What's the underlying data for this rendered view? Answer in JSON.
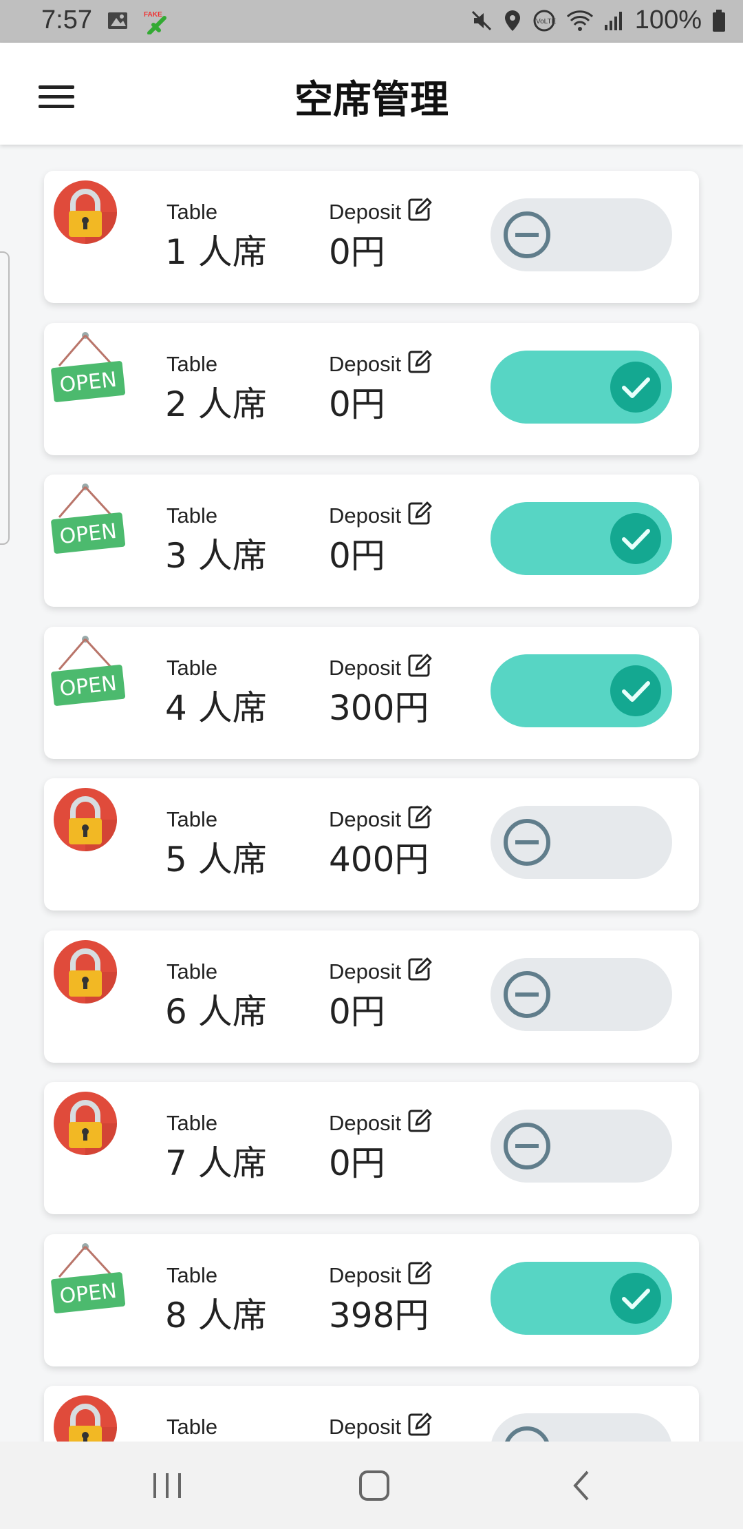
{
  "status_bar": {
    "time": "7:57",
    "battery": "100%"
  },
  "app_bar": {
    "title": "空席管理"
  },
  "tables": [
    {
      "table_label": "Table",
      "name": "1 人席",
      "deposit_label": "Deposit",
      "deposit": "0円",
      "status": "closed"
    },
    {
      "table_label": "Table",
      "name": "2 人席",
      "deposit_label": "Deposit",
      "deposit": "0円",
      "status": "open"
    },
    {
      "table_label": "Table",
      "name": "3 人席",
      "deposit_label": "Deposit",
      "deposit": "0円",
      "status": "open"
    },
    {
      "table_label": "Table",
      "name": "4 人席",
      "deposit_label": "Deposit",
      "deposit": "300円",
      "status": "open"
    },
    {
      "table_label": "Table",
      "name": "5 人席",
      "deposit_label": "Deposit",
      "deposit": "400円",
      "status": "closed"
    },
    {
      "table_label": "Table",
      "name": "6 人席",
      "deposit_label": "Deposit",
      "deposit": "0円",
      "status": "closed"
    },
    {
      "table_label": "Table",
      "name": "7 人席",
      "deposit_label": "Deposit",
      "deposit": "0円",
      "status": "closed"
    },
    {
      "table_label": "Table",
      "name": "8 人席",
      "deposit_label": "Deposit",
      "deposit": "398円",
      "status": "open"
    },
    {
      "table_label": "Table",
      "name": "",
      "deposit_label": "Deposit",
      "deposit": "",
      "status": "closed"
    }
  ],
  "open_sign_text": "OPEN",
  "colors": {
    "toggle_on": "#57d5c4",
    "toggle_off": "#e6e9ec",
    "check_knob": "#14a891",
    "minus_icon": "#607d8b",
    "lock_red": "#e04b3b",
    "open_green": "#4cba6e"
  },
  "nav": [
    "recent-apps",
    "home",
    "back"
  ]
}
